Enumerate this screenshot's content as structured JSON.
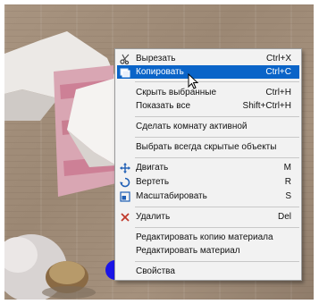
{
  "context_menu": {
    "items": [
      {
        "label": "Вырезать",
        "shortcut": "Ctrl+X",
        "icon": "scissors-icon"
      },
      {
        "label": "Копировать",
        "shortcut": "Ctrl+C",
        "icon": "copy-icon",
        "highlighted": true
      },
      {
        "label": "Скрыть выбранные",
        "shortcut": "Ctrl+H"
      },
      {
        "label": "Показать все",
        "shortcut": "Shift+Ctrl+H"
      },
      {
        "label": "Сделать комнату активной",
        "shortcut": ""
      },
      {
        "label": "Выбрать всегда скрытые объекты",
        "shortcut": ""
      },
      {
        "label": "Двигать",
        "shortcut": "M",
        "icon": "move-arrows-icon"
      },
      {
        "label": "Вертеть",
        "shortcut": "R",
        "icon": "rotate-icon"
      },
      {
        "label": "Масштабировать",
        "shortcut": "S",
        "icon": "scale-icon"
      },
      {
        "label": "Удалить",
        "shortcut": "Del",
        "icon": "delete-x-icon"
      },
      {
        "label": "Редактировать копию материала",
        "shortcut": ""
      },
      {
        "label": "Редактировать материал",
        "shortcut": ""
      },
      {
        "label": "Свойства",
        "shortcut": ""
      }
    ]
  },
  "colors": {
    "highlight": "#0a64c8",
    "menu_background": "#f2f2f2",
    "floor": "#a08c78",
    "pillow_pink": "#d88aa0",
    "blue_marker": "#1a14e8"
  }
}
